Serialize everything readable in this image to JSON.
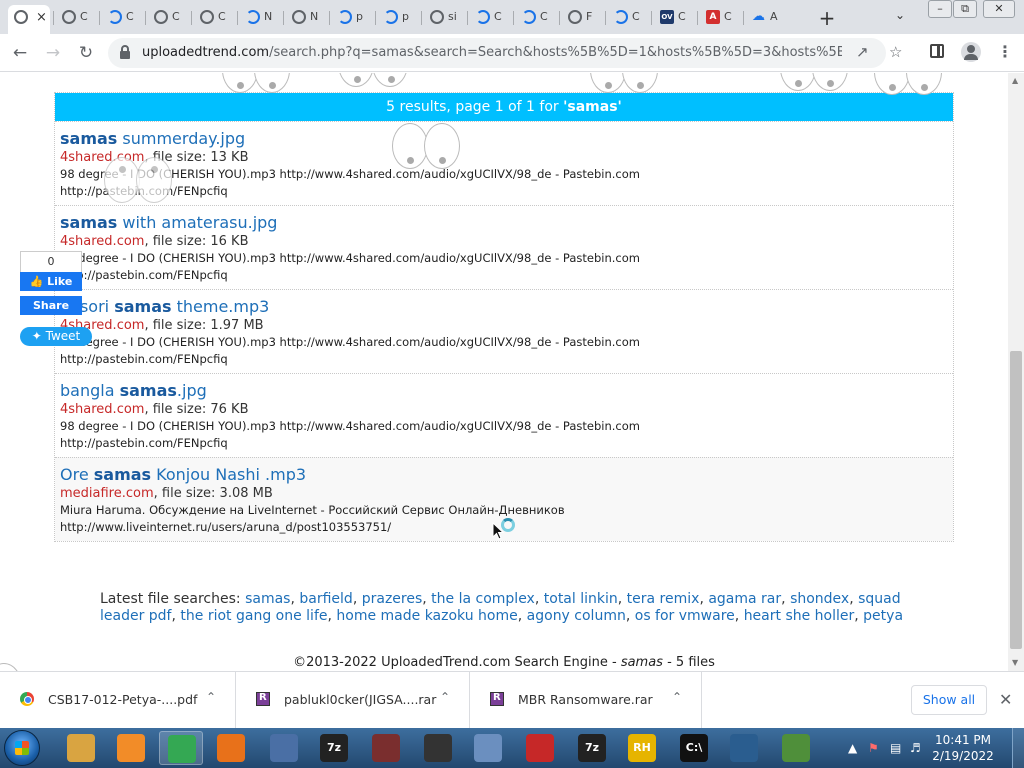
{
  "browser": {
    "tabs": [
      {
        "label": "C"
      },
      {
        "label": "C"
      },
      {
        "label": "C"
      },
      {
        "label": "C"
      },
      {
        "label": "N"
      },
      {
        "label": "N"
      },
      {
        "label": "p"
      },
      {
        "label": "p"
      },
      {
        "label": "si"
      },
      {
        "label": "C"
      },
      {
        "label": "C"
      },
      {
        "label": "F"
      },
      {
        "label": "C"
      },
      {
        "label": "C"
      },
      {
        "label": "C"
      },
      {
        "label": "A"
      },
      {
        "label": "A"
      }
    ],
    "favicon_ov": "OV",
    "favicon_pdf": "A",
    "new_tab": "+",
    "tab_close": "×",
    "url_host": "uploadedtrend.com",
    "url_path": "/search.php?q=samas&search=Search&hosts%5B%5D=1&hosts%5B%5D=3&hosts%5B%5D..."
  },
  "results": {
    "header_prefix": "5 results, page 1 of 1 for ",
    "header_query": "'samas'",
    "items": [
      {
        "pre": "",
        "bold": "samas",
        "post": " summerday.jpg",
        "site": "4shared.com",
        "size": ", file size: 13 KB",
        "desc1": "98 degree - I DO (CHERISH YOU).mp3 http://www.4shared.com/audio/xgUCIlVX/98_de - Pastebin.com",
        "desc2": "http://pastebin.com/FENpcfiq"
      },
      {
        "pre": "",
        "bold": "samas",
        "post": " with amaterasu.jpg",
        "site": "4shared.com",
        "size": ", file size: 16 KB",
        "desc1": "98 degree - I DO (CHERISH YOU).mp3 http://www.4shared.com/audio/xgUCIlVX/98_de - Pastebin.com",
        "desc2": "http://pastebin.com/FENpcfiq"
      },
      {
        "pre": "basori ",
        "bold": "samas",
        "post": " theme.mp3",
        "site": "4shared.com",
        "size": ", file size: 1.97 MB",
        "desc1": "98 degree - I DO (CHERISH YOU).mp3 http://www.4shared.com/audio/xgUCIlVX/98_de - Pastebin.com",
        "desc2": "http://pastebin.com/FENpcfiq"
      },
      {
        "pre": "bangla ",
        "bold": "samas",
        "post": ".jpg",
        "site": "4shared.com",
        "size": ", file size: 76 KB",
        "desc1": "98 degree - I DO (CHERISH YOU).mp3 http://www.4shared.com/audio/xgUCIlVX/98_de - Pastebin.com",
        "desc2": "http://pastebin.com/FENpcfiq"
      },
      {
        "pre": "Ore ",
        "bold": "samas",
        "post": " Konjou Nashi .mp3",
        "site": "mediafire.com",
        "size": ", file size: 3.08 MB",
        "desc1": "Miura Haruma. Обсуждение на LiveInternet - Российский Сервис Онлайн-Дневников",
        "desc2": "http://www.liveinternet.ru/users/aruna_d/post103553751/"
      }
    ]
  },
  "latest": {
    "label": "Latest file searches: ",
    "links": [
      "samas",
      "barfield",
      "prazeres",
      "the la complex",
      "total linkin",
      "tera remix",
      "agama rar",
      "shondex",
      "squad leader pdf",
      "the riot gang one life",
      "home made kazoku home",
      "agony column",
      "os for vmware",
      "heart she holler",
      "petya"
    ]
  },
  "footer": {
    "prefix": "©2013-2022 UploadedTrend.com Search Engine - ",
    "query": "samas",
    "suffix": " - 5 files"
  },
  "social": {
    "fb_count": "0",
    "fb_like": "Like",
    "fb_share": "Share",
    "tweet": "Tweet"
  },
  "downloads": {
    "items": [
      {
        "name": "CSB17-012-Petya-....pdf"
      },
      {
        "name": "pablukl0cker(JIGSA....rar"
      },
      {
        "name": "MBR Ransomware.rar"
      }
    ],
    "show_all": "Show all"
  },
  "taskbar": {
    "apps": [
      "",
      "",
      "",
      "",
      "",
      "7z",
      "",
      "",
      "",
      "",
      "7z",
      "RH",
      "C:\\",
      "",
      ""
    ],
    "time": "10:41 PM",
    "date": "2/19/2022"
  }
}
